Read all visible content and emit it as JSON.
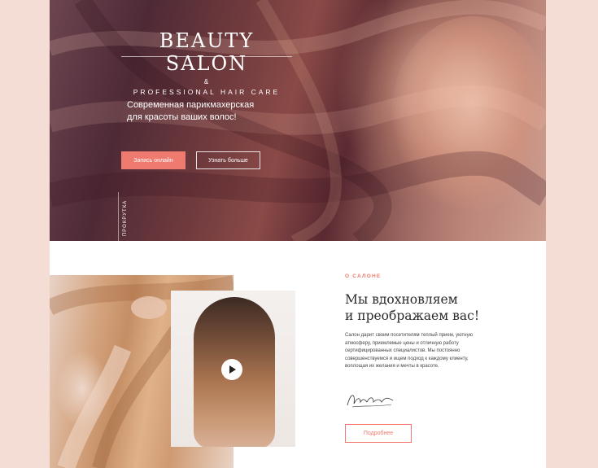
{
  "hero": {
    "brand_title": "BEAUTY SALON",
    "brand_amp": "&",
    "brand_subtitle": "PROFESSIONAL HAIR CARE",
    "tagline_line1": "Современная парикмахерская",
    "tagline_line2": "для красоты ваших волос!",
    "primary_button": "Запись онлайн",
    "secondary_button": "Узнать больше",
    "scroll_label": "ПРОКРУТКА"
  },
  "about": {
    "label": "О САЛОНЕ",
    "title_line1": "Мы вдохновляем",
    "title_line2": "и преображаем вас!",
    "text": "Салон дарит своим посетителям теплый прием, уютную атмосферу, приемлемые цены и отличную работу сертифицированных специалистов. Мы постоянно совершенствуемся и ищем подход к каждому клиенту, воплощая их желания и мечты в красоте.",
    "button": "Подробнее"
  },
  "colors": {
    "accent": "#ef7a6f",
    "page_background": "#f3ddd5"
  },
  "icons": {
    "play": "play-icon",
    "signature": "signature-icon"
  }
}
